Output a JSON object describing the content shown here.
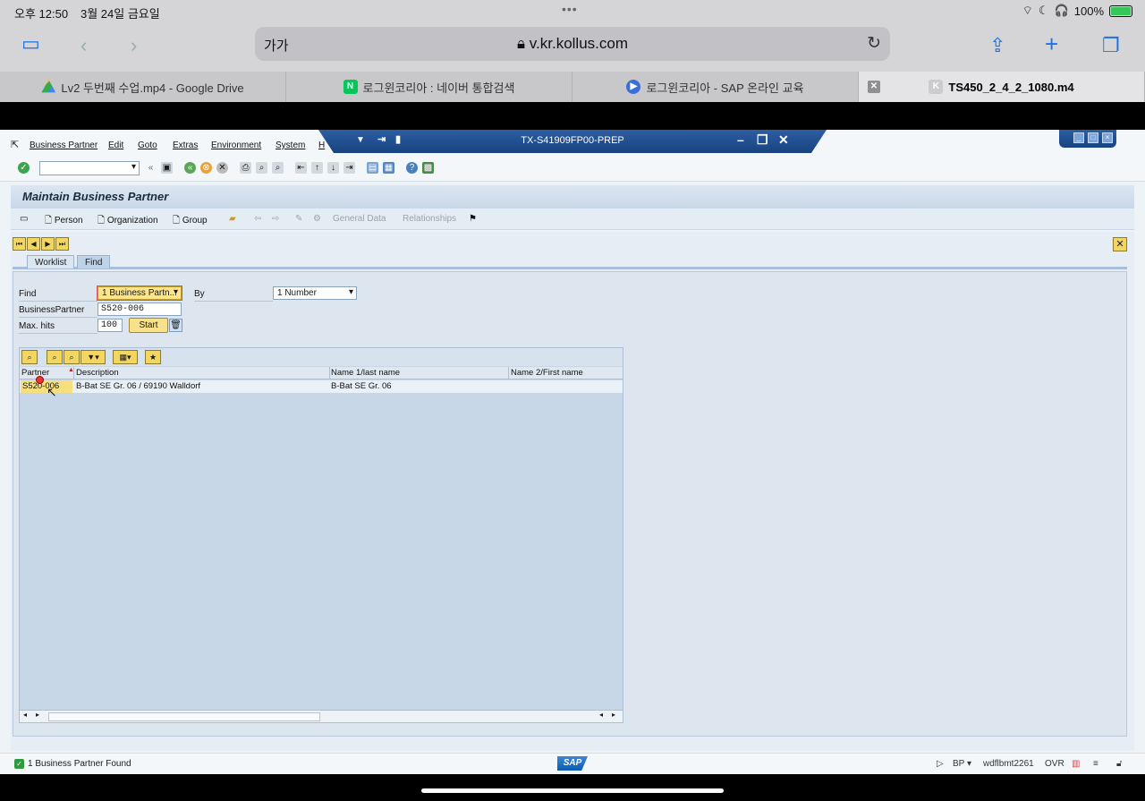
{
  "ios": {
    "time": "오후 12:50",
    "date": "3월 24일 금요일",
    "dots": "•••",
    "battery": "100%"
  },
  "safari": {
    "text_size": "가가",
    "url": "v.kr.kollus.com",
    "tabs": [
      {
        "label": "Lv2 두번째 수업.mp4 - Google Drive",
        "icon": "google-drive-icon",
        "active": false
      },
      {
        "label": "로그윈코리아 : 네이버 통합검색",
        "icon": "naver-icon",
        "active": false
      },
      {
        "label": "로그윈코리아 - SAP 온라인 교육",
        "icon": "play-icon",
        "active": false
      },
      {
        "label": "TS450_2_4_2_1080.m4",
        "icon": "kollus-icon",
        "active": true
      }
    ],
    "tab_badge": "K",
    "naver_badge": "N"
  },
  "sap": {
    "menu": [
      "Business Partner",
      "Edit",
      "Goto",
      "Extras",
      "Environment",
      "System",
      "H"
    ],
    "window_title": "TX-S41909FP00-PREP",
    "screen_title": "Maintain Business Partner",
    "app_toolbar": {
      "person": "Person",
      "organization": "Organization",
      "group": "Group",
      "general_data": "General Data",
      "relationships": "Relationships"
    },
    "tabs": {
      "worklist": "Worklist",
      "find": "Find"
    },
    "find": {
      "find_label": "Find",
      "find_value": "1 Business Partn...",
      "by_label": "By",
      "by_value": "1 Number",
      "bp_label": "BusinessPartner",
      "bp_value": "S520-006",
      "maxhits_label": "Max. hits",
      "maxhits_value": "100",
      "start_label": "Start"
    },
    "results": {
      "columns": [
        "Partner",
        "Description",
        "Name 1/last name",
        "Name 2/First name"
      ],
      "rows": [
        {
          "partner": "S520-006",
          "description": "B-Bat SE Gr. 06 / 69190 Walldorf",
          "name1": "B-Bat SE Gr. 06",
          "name2": ""
        }
      ]
    },
    "status": {
      "message": "1 Business Partner Found",
      "logo": "SAP",
      "transaction": "BP",
      "server": "wdflbmt2261",
      "mode": "OVR"
    }
  }
}
